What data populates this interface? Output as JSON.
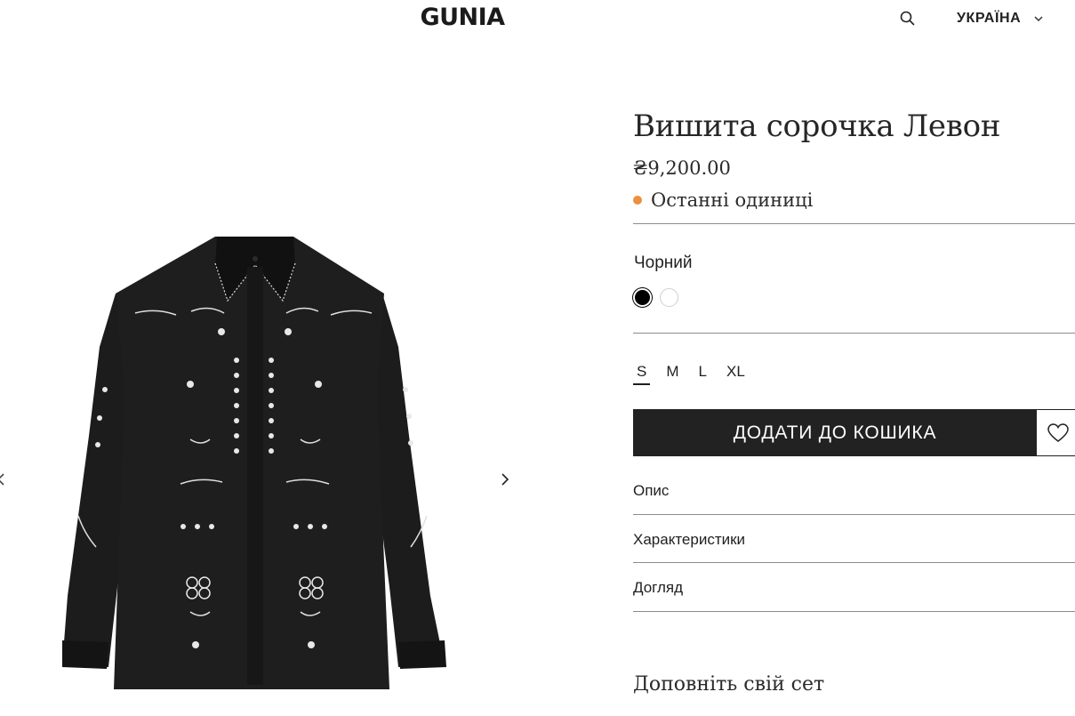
{
  "header": {
    "logo": "GUNIA",
    "region": "УКРАЇНА"
  },
  "product": {
    "title": "Вишита сорочка Левон",
    "price": "₴9,200.00",
    "stock_status": "Останні одиниці",
    "stock_color": "#ec8f3f",
    "color_label": "Чорний",
    "colors": [
      "#000000",
      "#ffffff"
    ],
    "sizes": [
      "S",
      "M",
      "L",
      "XL"
    ],
    "selected_size": "S",
    "add_to_cart": "ДОДАТИ ДО КОШИКА",
    "accordion": [
      "Опис",
      "Характеристики",
      "Догляд"
    ],
    "complete_set": "Доповніть свій сет"
  },
  "icons": {
    "search": "search-icon",
    "region_toggle": "chevron-down-icon",
    "prev": "chevron-left-icon",
    "next": "chevron-right-icon",
    "wishlist": "heart-icon"
  }
}
